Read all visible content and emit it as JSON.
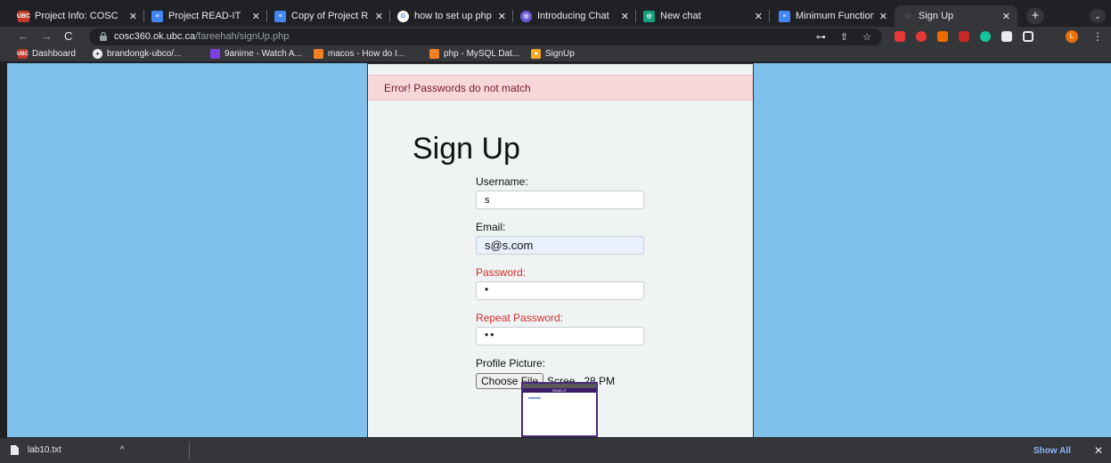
{
  "browser": {
    "tabs": [
      {
        "title": "Project Info: COSC",
        "favicon": "ubc-icon",
        "color": "#c0392b"
      },
      {
        "title": "Project READ-IT",
        "favicon": "google-docs-icon",
        "color": "#4285f4"
      },
      {
        "title": "Copy of Project R",
        "favicon": "google-docs-icon",
        "color": "#4285f4"
      },
      {
        "title": "how to set up php",
        "favicon": "google-icon",
        "color": "#ffffff"
      },
      {
        "title": "Introducing Chat",
        "favicon": "openai-icon",
        "color": "#6b5bd6"
      },
      {
        "title": "New chat",
        "favicon": "openai-icon",
        "color": "#10a37f"
      },
      {
        "title": "Minimum Function",
        "favicon": "google-docs-icon",
        "color": "#4285f4"
      },
      {
        "title": "Sign Up",
        "favicon": "globe-icon",
        "color": "#9aa0a6"
      }
    ],
    "active_tab": 7,
    "new_tab_label": "+",
    "tab_search_label": "⌄",
    "url_host": "cosc360.ok.ubc.ca",
    "url_path": "/fareehah/signUp.php",
    "profile_initial": "L",
    "bookmarks": [
      {
        "label": "Dashboard",
        "icon": "ubc-icon",
        "color": "#c0392b"
      },
      {
        "label": "brandongk-ubco/...",
        "icon": "github-icon",
        "color": "#e8eaed"
      },
      {
        "label": "9anime - Watch A...",
        "icon": "9anime-icon",
        "color": "#7b3fe4"
      },
      {
        "label": "macos - How do I...",
        "icon": "stackoverflow-icon",
        "color": "#f48024"
      },
      {
        "label": "php - MySQL Dat...",
        "icon": "stackoverflow-icon",
        "color": "#f48024"
      },
      {
        "label": "SignUp",
        "icon": "signup-icon",
        "color": "#f9a825"
      }
    ]
  },
  "page": {
    "error_message": "Error! Passwords do not match",
    "heading": "Sign Up",
    "username_label": "Username:",
    "username_value": "s",
    "email_label": "Email:",
    "email_value": "s@s.com",
    "password_label": "Password:",
    "password_value": "•",
    "repeat_password_label": "Repeat Password:",
    "repeat_password_value": "••",
    "profile_picture_label": "Profile Picture:",
    "choose_file_label": "Choose File",
    "file_name": "Scree...28 PM",
    "thumbnail_title": "READ-IT",
    "error_color": "#d32f2f",
    "page_background": "#7fc1ea"
  },
  "downloads": {
    "file": "lab10.txt",
    "show_all": "Show All",
    "close": "✕"
  }
}
